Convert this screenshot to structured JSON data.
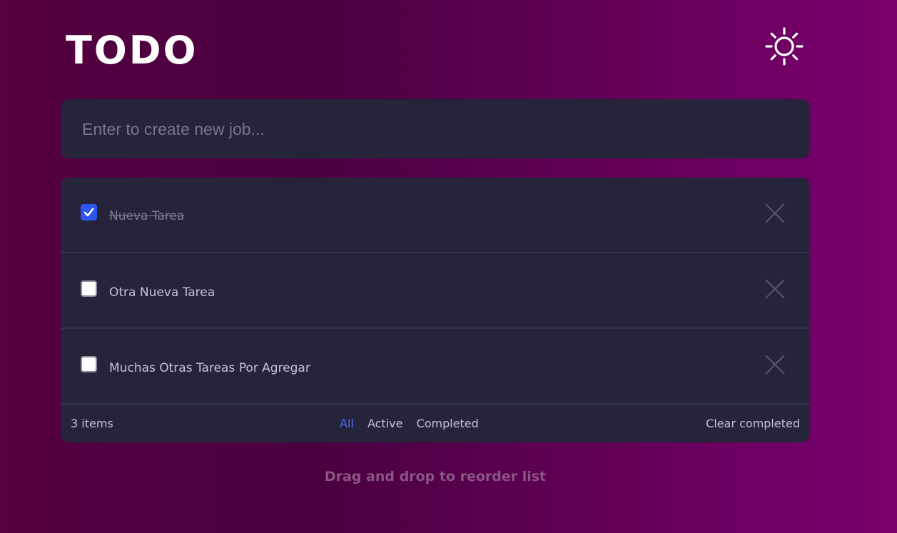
{
  "header": {
    "title": "TODO",
    "theme_icon": "sun-icon"
  },
  "new_job": {
    "placeholder": "Enter to create new job...",
    "value": ""
  },
  "todos": [
    {
      "label": "Nueva Tarea",
      "completed": true
    },
    {
      "label": "Otra Nueva Tarea",
      "completed": false
    },
    {
      "label": "Muchas Otras Tareas Por Agregar",
      "completed": false
    }
  ],
  "footer": {
    "count_label": "3 items",
    "filters": [
      {
        "label": "All",
        "active": true
      },
      {
        "label": "Active",
        "active": false
      },
      {
        "label": "Completed",
        "active": false
      }
    ],
    "clear_label": "Clear completed"
  },
  "hint": "Drag and drop to reorder list",
  "colors": {
    "accent": "#4f6ef0",
    "checkbox_checked": "#2f55f0",
    "card_bg": "#25243b",
    "text": "#c4c2d8"
  }
}
